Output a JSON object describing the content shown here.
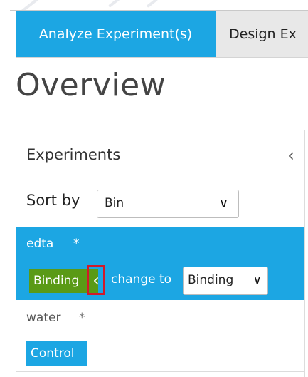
{
  "tabs": [
    {
      "label": "Analyze Experiment(s)",
      "active": true
    },
    {
      "label": "Design Ex",
      "active": false
    }
  ],
  "page": {
    "title": "Overview"
  },
  "panel": {
    "heading": "Experiments",
    "collapse_icon": "chevron-left-icon",
    "sort": {
      "label": "Sort by",
      "selected": "Bin",
      "icon": "chevron-down-icon"
    },
    "experiments": [
      {
        "name": "edta",
        "marker": "*",
        "category": "Binding",
        "move_icon": "chevron-left-icon",
        "change_label": "change to",
        "change_selected": "Binding",
        "selected": true
      },
      {
        "name": "water",
        "marker": "*",
        "category": "Control",
        "selected": false
      }
    ]
  },
  "colors": {
    "accent": "#1ca6e3",
    "binding_badge": "#5a9a16",
    "highlight_box": "#d11a2a"
  }
}
